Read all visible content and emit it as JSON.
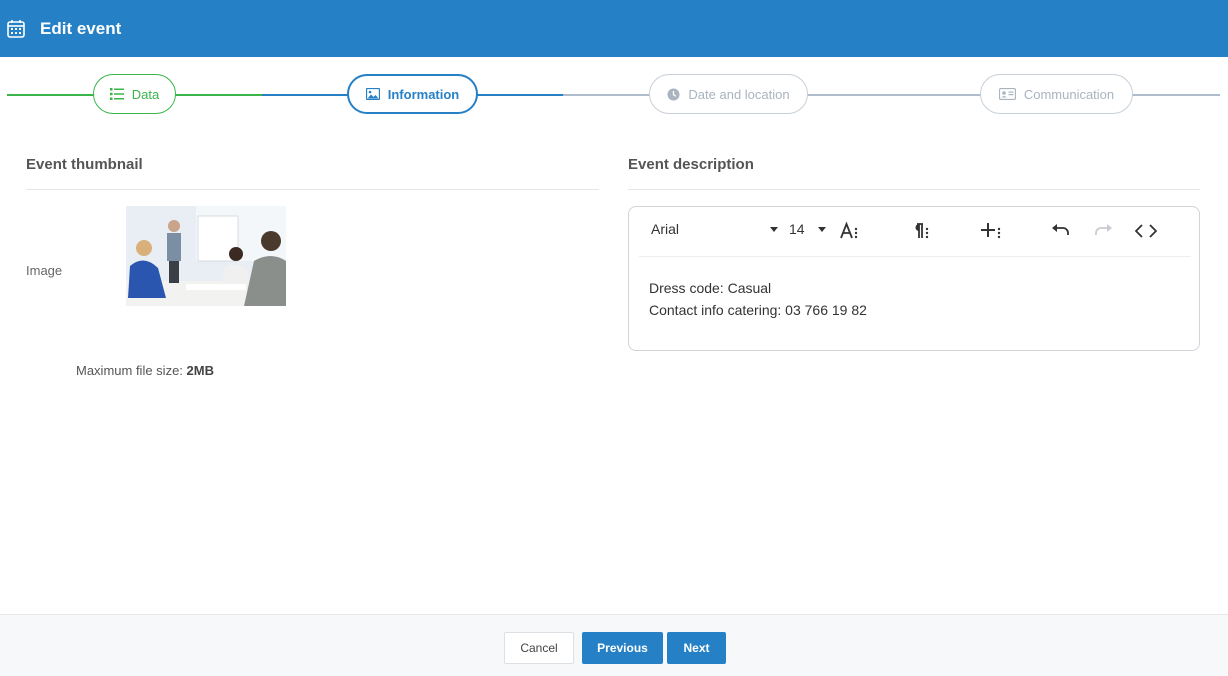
{
  "header": {
    "title": "Edit event",
    "icon": "calendar-icon"
  },
  "steps": [
    {
      "label": "Data",
      "state": "done",
      "icon": "list-icon"
    },
    {
      "label": "Information",
      "state": "active",
      "icon": "image-icon"
    },
    {
      "label": "Date and location",
      "state": "pending",
      "icon": "clock-icon"
    },
    {
      "label": "Communication",
      "state": "pending",
      "icon": "id-card-icon"
    }
  ],
  "left": {
    "title": "Event thumbnail",
    "image_label": "Image",
    "max_size_label": "Maximum file size:",
    "max_size_value": "2MB"
  },
  "right": {
    "title": "Event description",
    "toolbar": {
      "font": "Arial",
      "size": "14"
    },
    "content": [
      "Dress code: Casual",
      "Contact info catering: 03 766 19 82"
    ]
  },
  "footer": {
    "cancel": "Cancel",
    "previous": "Previous",
    "next": "Next"
  },
  "colors": {
    "primary": "#2580c6",
    "success": "#3bb54a",
    "pending": "#a9b4c0"
  }
}
